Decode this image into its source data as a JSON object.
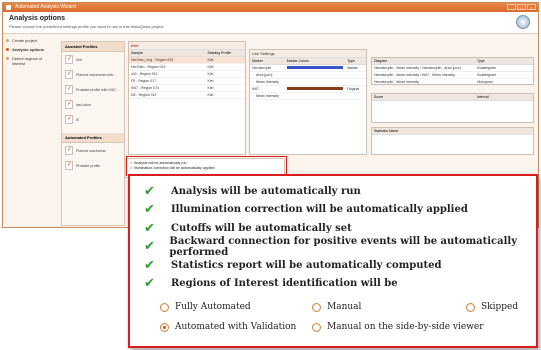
{
  "window": {
    "title": "Automated Analysis Wizard",
    "header_title": "Analysis options",
    "header_subtitle": "Please choose the predefined settings profile you want to use in this HistoQuest project"
  },
  "steps": [
    "Create project",
    "Analysis options",
    "Detect regions of interest"
  ],
  "profiles": {
    "assisted_title": "Assisted Profiles",
    "assisted_items": [
      "Kiel",
      "Plasma carcinoma with...",
      "Prostate profile with KI67...",
      "last colon",
      "IE"
    ],
    "automated_title": "Automated Profiles",
    "automated_items": [
      "Plasma carcinoma",
      "Prostate profile"
    ]
  },
  "samples": {
    "title": "Kiel",
    "col_sample": "Sample",
    "col_profile": "Staining Profile",
    "rows": [
      {
        "sample": "Her2neu_Img - Region 003",
        "profile": "Kiel"
      },
      {
        "sample": "Her2neu - Region 019",
        "profile": "Kiel"
      },
      {
        "sample": "c02 - Region 011",
        "profile": "Kiel"
      },
      {
        "sample": "F8 - Region 017",
        "profile": "Kiel"
      },
      {
        "sample": "Ki67 - Region 074",
        "profile": "Kiel"
      },
      {
        "sample": "D8 - Region 012",
        "profile": "Kiel"
      }
    ]
  },
  "markers": {
    "title": "Use Settings",
    "col_marker": "Marker",
    "col_colors": "Marker Colors",
    "col_type": "Type",
    "rows": [
      {
        "name": "Hematoxylin",
        "type": "Master",
        "color": "#3a55c8"
      },
      {
        "name": "Area [µm²]",
        "type": "",
        "color": ""
      },
      {
        "name": "Mean Intensity",
        "type": "",
        "color": ""
      },
      {
        "name": "Ki67",
        "type": "Original",
        "color": "#8a3b1a"
      },
      {
        "name": "Mean Intensity",
        "type": "",
        "color": ""
      }
    ]
  },
  "diagrams": {
    "col_diagram": "Diagram",
    "col_type": "Type",
    "rows": [
      {
        "diagram": "Hematoxylin - Mean Intensity / Hematoxylin - Area [µm²]",
        "type": "Scattergram"
      },
      {
        "diagram": "Hematoxylin - Mean Intensity / Ki67 - Mean Intensity",
        "type": "Scattergram"
      },
      {
        "diagram": "Hematoxylin - Mean Intensity",
        "type": "Histogram"
      }
    ],
    "col_score": "Score",
    "col_interval": "Interval",
    "col_stats": "Statistics Name"
  },
  "summary_small": [
    "Analysis will be automatically run",
    "Illumination correction will be automatically applied"
  ],
  "callout": {
    "items": [
      "Analysis will be automatically run",
      "Illumination correction will be automatically applied",
      "Cutoffs will be automatically set",
      "Backward connection for positive events will be automatically performed",
      "Statistics report will be automatically computed"
    ],
    "roi_title": "Regions of Interest identification will be",
    "options": {
      "fully_automated": "Fully Automated",
      "manual": "Manual",
      "skipped": "Skipped",
      "automated_validation": "Automated with Validation",
      "manual_side": "Manual on the side-by-side viewer"
    },
    "selected": "automated_validation"
  }
}
